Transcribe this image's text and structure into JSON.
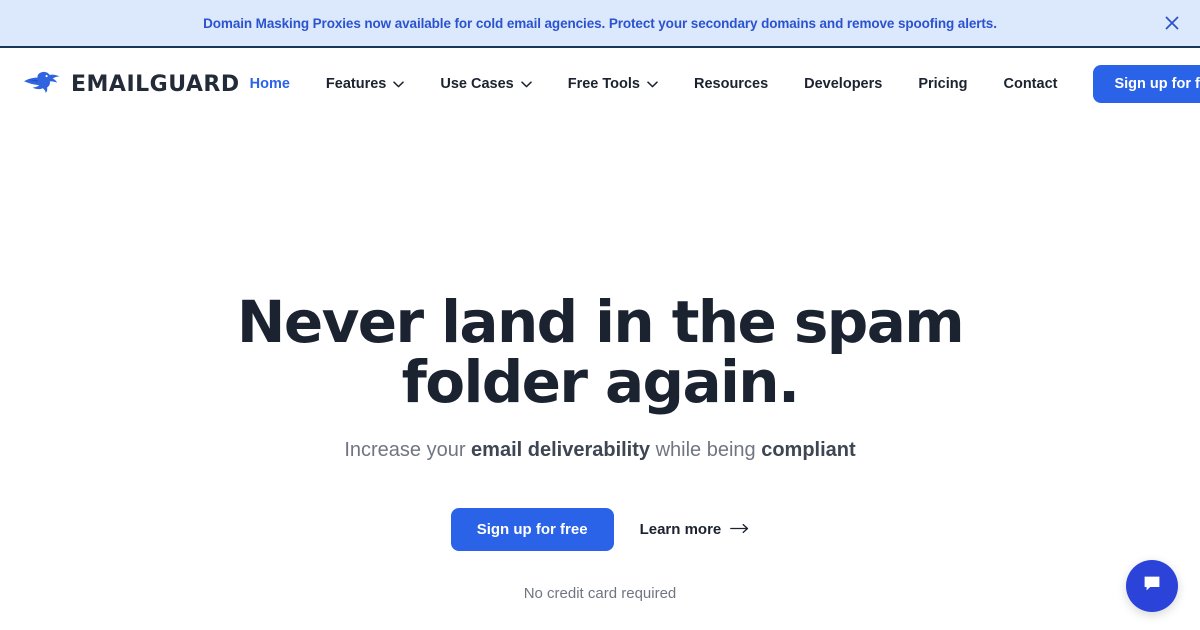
{
  "announcement": {
    "text": "Domain Masking Proxies now available for cold email agencies. Protect your secondary domains and remove spoofing alerts.",
    "close_label": "×",
    "background_color": "#dce8fb",
    "text_color": "#2b53cf",
    "border_color": "#16385c"
  },
  "header": {
    "brand_name": "EMAILGUARD",
    "brand_icon": "falcon-bird-icon",
    "nav": [
      {
        "label": "Home",
        "has_dropdown": false,
        "active": true
      },
      {
        "label": "Features",
        "has_dropdown": true,
        "active": false
      },
      {
        "label": "Use Cases",
        "has_dropdown": true,
        "active": false
      },
      {
        "label": "Free Tools",
        "has_dropdown": true,
        "active": false
      },
      {
        "label": "Resources",
        "has_dropdown": false,
        "active": false
      },
      {
        "label": "Developers",
        "has_dropdown": false,
        "active": false
      },
      {
        "label": "Pricing",
        "has_dropdown": false,
        "active": false
      },
      {
        "label": "Contact",
        "has_dropdown": false,
        "active": false
      }
    ],
    "cta_label": "Sign up for free",
    "cta_color": "#2b63e8",
    "active_link_color": "#2b63e8"
  },
  "hero": {
    "title_line1": "Never land in the spam folder",
    "title_line2": "again.",
    "subtitle_pre": "Increase your ",
    "subtitle_bold1": "email deliverability",
    "subtitle_mid": " while being ",
    "subtitle_bold2": "compliant",
    "primary_cta": "Sign up for free",
    "secondary_cta": "Learn more",
    "secondary_cta_icon": "arrow-right-icon",
    "note": "No credit card required",
    "title_color": "#1b2230",
    "subtitle_color": "#6f7682"
  },
  "chat": {
    "icon": "chat-bubble-icon",
    "color": "#2b43d8"
  }
}
